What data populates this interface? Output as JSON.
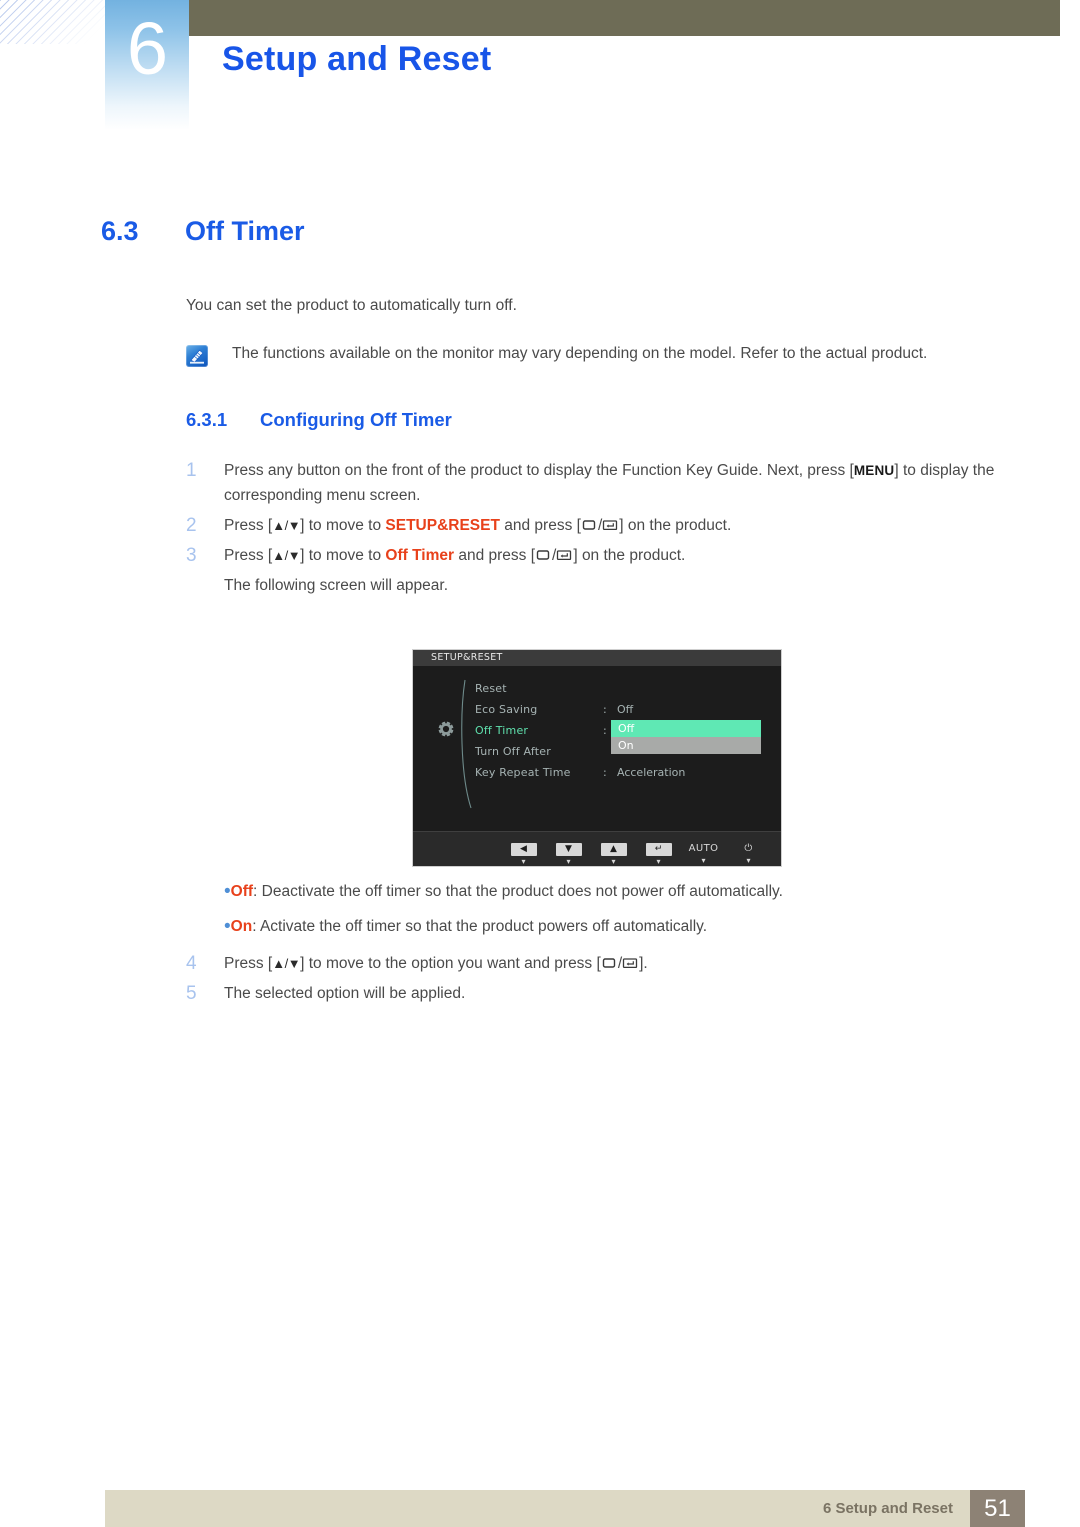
{
  "header": {
    "chapter_number": "6",
    "chapter_title": "Setup and Reset"
  },
  "section": {
    "number": "6.3",
    "title": "Off Timer"
  },
  "intro": "You can set the product to automatically turn off.",
  "note": {
    "icon": "note-pencil-icon",
    "text": "The functions available on the monitor may vary depending on the model. Refer to the actual product."
  },
  "subsection": {
    "number": "6.3.1",
    "title": "Configuring Off Timer"
  },
  "steps": [
    {
      "num": "1",
      "parts": [
        {
          "type": "text",
          "value": "Press any button on the front of the product to display the Function Key Guide. Next, press ["
        },
        {
          "type": "bold_key",
          "value": "MENU"
        },
        {
          "type": "text",
          "value": "] to display the corresponding menu screen."
        }
      ]
    },
    {
      "num": "2",
      "parts": [
        {
          "type": "text",
          "value": "Press ["
        },
        {
          "type": "updown",
          "value": "▲/▼"
        },
        {
          "type": "text",
          "value": "] to move to "
        },
        {
          "type": "keyword",
          "value": "SETUP&RESET"
        },
        {
          "type": "text",
          "value": " and press ["
        },
        {
          "type": "glyph_box",
          "value": "box-icon"
        },
        {
          "type": "text",
          "value": "/"
        },
        {
          "type": "glyph_enter",
          "value": "enter-icon"
        },
        {
          "type": "text",
          "value": "] on the product."
        }
      ]
    },
    {
      "num": "3",
      "parts": [
        {
          "type": "text",
          "value": "Press ["
        },
        {
          "type": "updown",
          "value": "▲/▼"
        },
        {
          "type": "text",
          "value": "] to move to "
        },
        {
          "type": "keyword",
          "value": "Off Timer"
        },
        {
          "type": "text",
          "value": " and press ["
        },
        {
          "type": "glyph_box",
          "value": "box-icon"
        },
        {
          "type": "text",
          "value": "/"
        },
        {
          "type": "glyph_enter",
          "value": "enter-icon"
        },
        {
          "type": "text",
          "value": "] on the product."
        }
      ]
    }
  ],
  "following_screen_line": "The following screen will appear.",
  "osd": {
    "title": "SETUP&RESET",
    "gear_icon": "gear-icon",
    "rows": [
      {
        "label": "Reset",
        "colon": "",
        "value": "",
        "selected": false
      },
      {
        "label": "Eco Saving",
        "colon": ":",
        "value": "Off",
        "selected": false
      },
      {
        "label": "Off Timer",
        "colon": ":",
        "value": "",
        "selected": true
      },
      {
        "label": "Turn Off After",
        "colon": "",
        "value": "",
        "selected": false
      },
      {
        "label": "Key Repeat Time",
        "colon": ":",
        "value": "Acceleration",
        "selected": false
      }
    ],
    "dropdown": {
      "options": [
        "Off",
        "On"
      ],
      "selected": "Off",
      "highlight_color": "#5fe8b4",
      "inactive_color": "#a8aaa8"
    },
    "buttons": [
      {
        "name": "left-arrow-button",
        "glyph": "◀",
        "style": "fill"
      },
      {
        "name": "down-arrow-button",
        "glyph": "▼",
        "style": "fill"
      },
      {
        "name": "up-arrow-button",
        "glyph": "▲",
        "style": "fill"
      },
      {
        "name": "enter-button",
        "glyph": "↵",
        "style": "fill"
      },
      {
        "name": "auto-button",
        "glyph": "AUTO",
        "style": "nofill"
      },
      {
        "name": "power-button",
        "glyph": "⏻",
        "style": "nofill"
      }
    ],
    "button_caret": "▾"
  },
  "bullets": [
    {
      "dot": "•",
      "keyword": "Off",
      "text": ": Deactivate the off timer so that the product does not power off automatically."
    },
    {
      "dot": "•",
      "keyword": "On",
      "text": ": Activate the off timer so that the product powers off automatically."
    }
  ],
  "steps2": [
    {
      "num": "4",
      "parts": [
        {
          "type": "text",
          "value": "Press ["
        },
        {
          "type": "updown",
          "value": "▲/▼"
        },
        {
          "type": "text",
          "value": "] to move to the option you want and press ["
        },
        {
          "type": "glyph_box",
          "value": "box-icon"
        },
        {
          "type": "text",
          "value": "/"
        },
        {
          "type": "glyph_enter",
          "value": "enter-icon"
        },
        {
          "type": "text",
          "value": "]."
        }
      ]
    },
    {
      "num": "5",
      "parts": [
        {
          "type": "text",
          "value": "The selected option will be applied."
        }
      ]
    }
  ],
  "footer": {
    "text": "6 Setup and Reset",
    "page_number": "51"
  },
  "colors": {
    "heading_blue": "#1a5be6",
    "keyword_orange": "#e8411b",
    "olive_bar": "#6e6c56",
    "footer_bar": "#ddd9c5",
    "footer_page_box": "#8d8275",
    "step_number_blue": "#a8c3ee"
  }
}
